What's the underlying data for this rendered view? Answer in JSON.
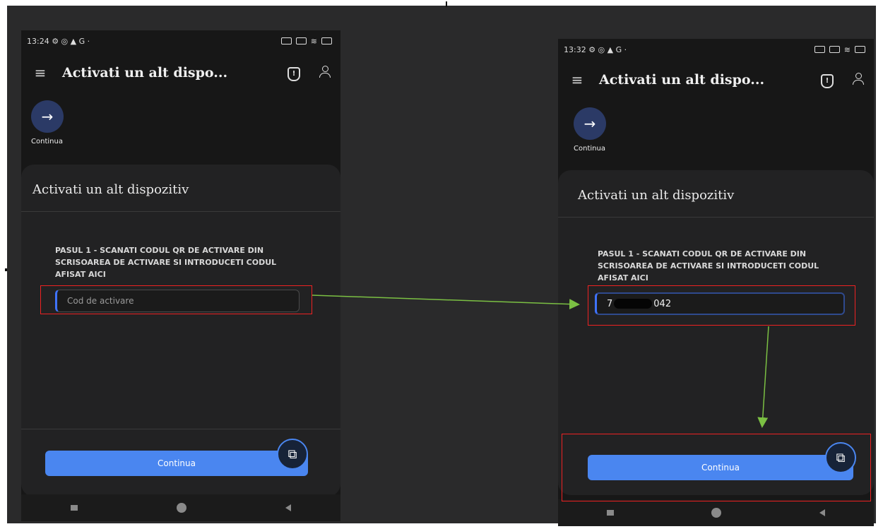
{
  "left_phone": {
    "status_time": "13:24",
    "status_left_icons": "⚙ ◎ ▲ G ·",
    "title": "Activati un alt dispo...",
    "continue_fab_label": "Continua",
    "card_title": "Activati un alt dispozitiv",
    "instructions": "PASUL 1 - SCANATI CODUL QR DE ACTIVARE DIN SCRISOAREA DE ACTIVARE SI INTRODUCETI CODUL AFISAT AICI",
    "code_placeholder": "Cod de activare",
    "continue_button": "Continua"
  },
  "right_phone": {
    "status_time": "13:32",
    "status_left_icons": "⚙ ◎ ▲ G ·",
    "title": "Activati un alt dispo...",
    "continue_fab_label": "Continua",
    "card_title": "Activati un alt dispozitiv",
    "instructions": "PASUL 1 - SCANATI CODUL QR DE ACTIVARE DIN SCRISOAREA DE ACTIVARE SI INTRODUCETI CODUL AFISAT AICI",
    "code_value_prefix": "7",
    "code_value_suffix": "042",
    "continue_button": "Continua"
  },
  "colors": {
    "accent": "#4a86f0",
    "annotation_red": "#e22222",
    "annotation_arrow": "#7bc043"
  },
  "icons": [
    "menu-icon",
    "shield-icon",
    "person-icon",
    "arrow-right-icon",
    "layers-icon",
    "nav-recents-icon",
    "nav-home-icon",
    "nav-back-icon"
  ]
}
